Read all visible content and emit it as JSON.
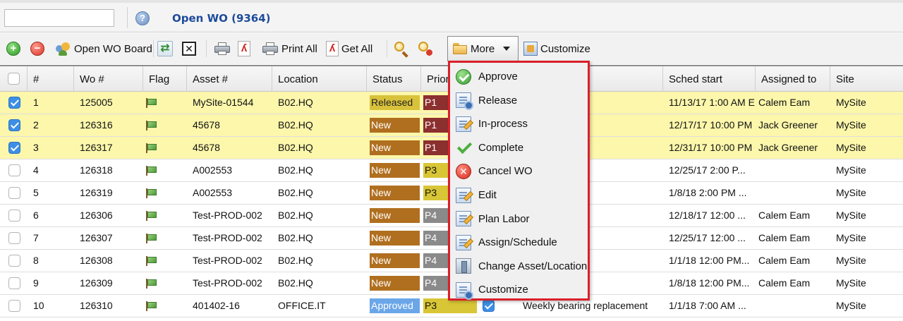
{
  "header": {
    "search_value": "",
    "help_glyph": "?",
    "title": "Open WO (9364)"
  },
  "toolbar": {
    "open_wo_board_label": "Open WO Board",
    "print_all_label": "Print All",
    "get_all_label": "Get All",
    "more_label": "More",
    "customize_label": "Customize",
    "add_glyph": "+",
    "remove_glyph": "−",
    "close_glyph": "✕",
    "pdf_glyph": "ʎ",
    "refresh_glyph": "⇄"
  },
  "columns": [
    "#",
    "Wo #",
    "Flag",
    "Asset #",
    "Location",
    "Status",
    "Prior",
    "Sched start",
    "Assigned to",
    "Site"
  ],
  "rows": [
    {
      "checked": true,
      "num": "1",
      "wo": "125005",
      "asset": "MySite-01544",
      "location": "B02.HQ",
      "status": "Released",
      "prio": "P1",
      "sched": "11/13/17 1:00 AM E",
      "assigned": "Calem Eam",
      "site": "MySite"
    },
    {
      "checked": true,
      "num": "2",
      "wo": "126316",
      "asset": "45678",
      "location": "B02.HQ",
      "status": "New",
      "prio": "P1",
      "sched": "12/17/17 10:00 PM",
      "assigned": "Jack Greener",
      "site": "MySite"
    },
    {
      "checked": true,
      "num": "3",
      "wo": "126317",
      "asset": "45678",
      "location": "B02.HQ",
      "status": "New",
      "prio": "P1",
      "sched": "12/31/17 10:00 PM",
      "assigned": "Jack Greener",
      "site": "MySite"
    },
    {
      "checked": false,
      "num": "4",
      "wo": "126318",
      "asset": "A002553",
      "location": "B02.HQ",
      "status": "New",
      "prio": "P3",
      "sched": "12/25/17 2:00 P...",
      "assigned": "",
      "site": "MySite"
    },
    {
      "checked": false,
      "num": "5",
      "wo": "126319",
      "asset": "A002553",
      "location": "B02.HQ",
      "status": "New",
      "prio": "P3",
      "sched": "1/8/18 2:00 PM ...",
      "assigned": "",
      "site": "MySite"
    },
    {
      "checked": false,
      "num": "6",
      "wo": "126306",
      "asset": "Test-PROD-002",
      "location": "B02.HQ",
      "status": "New",
      "prio": "P4",
      "sched": "12/18/17 12:00 ...",
      "assigned": "Calem Eam",
      "site": "MySite"
    },
    {
      "checked": false,
      "num": "7",
      "wo": "126307",
      "asset": "Test-PROD-002",
      "location": "B02.HQ",
      "status": "New",
      "prio": "P4",
      "sched": "12/25/17 12:00 ...",
      "assigned": "Calem Eam",
      "site": "MySite"
    },
    {
      "checked": false,
      "num": "8",
      "wo": "126308",
      "asset": "Test-PROD-002",
      "location": "B02.HQ",
      "status": "New",
      "prio": "P4",
      "sched": "1/1/18 12:00 PM...",
      "assigned": "Calem Eam",
      "site": "MySite"
    },
    {
      "checked": false,
      "num": "9",
      "wo": "126309",
      "asset": "Test-PROD-002",
      "location": "B02.HQ",
      "status": "New",
      "prio": "P4",
      "sched": "1/8/18 12:00 PM...",
      "assigned": "Calem Eam",
      "site": "MySite"
    },
    {
      "checked": false,
      "num": "10",
      "wo": "126310",
      "asset": "401402-16",
      "location": "OFFICE.IT",
      "status": "Approved",
      "prio": "P3",
      "sched": "1/1/18 7:00 AM ...",
      "assigned": "",
      "site": "MySite",
      "description": "Weekly bearing replacement"
    }
  ],
  "more_menu": [
    {
      "label": "Approve",
      "icon": "approve-icon"
    },
    {
      "label": "Release",
      "icon": "release-icon"
    },
    {
      "label": "In-process",
      "icon": "in-process-icon"
    },
    {
      "label": "Complete",
      "icon": "complete-icon"
    },
    {
      "label": "Cancel WO",
      "icon": "cancel-icon"
    },
    {
      "label": "Edit",
      "icon": "edit-icon"
    },
    {
      "label": "Plan Labor",
      "icon": "plan-labor-icon"
    },
    {
      "label": "Assign/Schedule",
      "icon": "assign-schedule-icon"
    },
    {
      "label": "Change Asset/Location",
      "icon": "change-asset-icon"
    },
    {
      "label": "Customize",
      "icon": "customize-icon"
    }
  ],
  "colors": {
    "title": "#1d4b9b",
    "selected_row": "#fcf7ab",
    "menu_border": "#d9202a",
    "status_released": "#d9c23b",
    "status_new": "#b06f1f",
    "status_approved": "#6aa6e8",
    "prio_p1": "#8c2f2f",
    "prio_p3": "#d8c636",
    "prio_p4": "#8a8a8a"
  }
}
